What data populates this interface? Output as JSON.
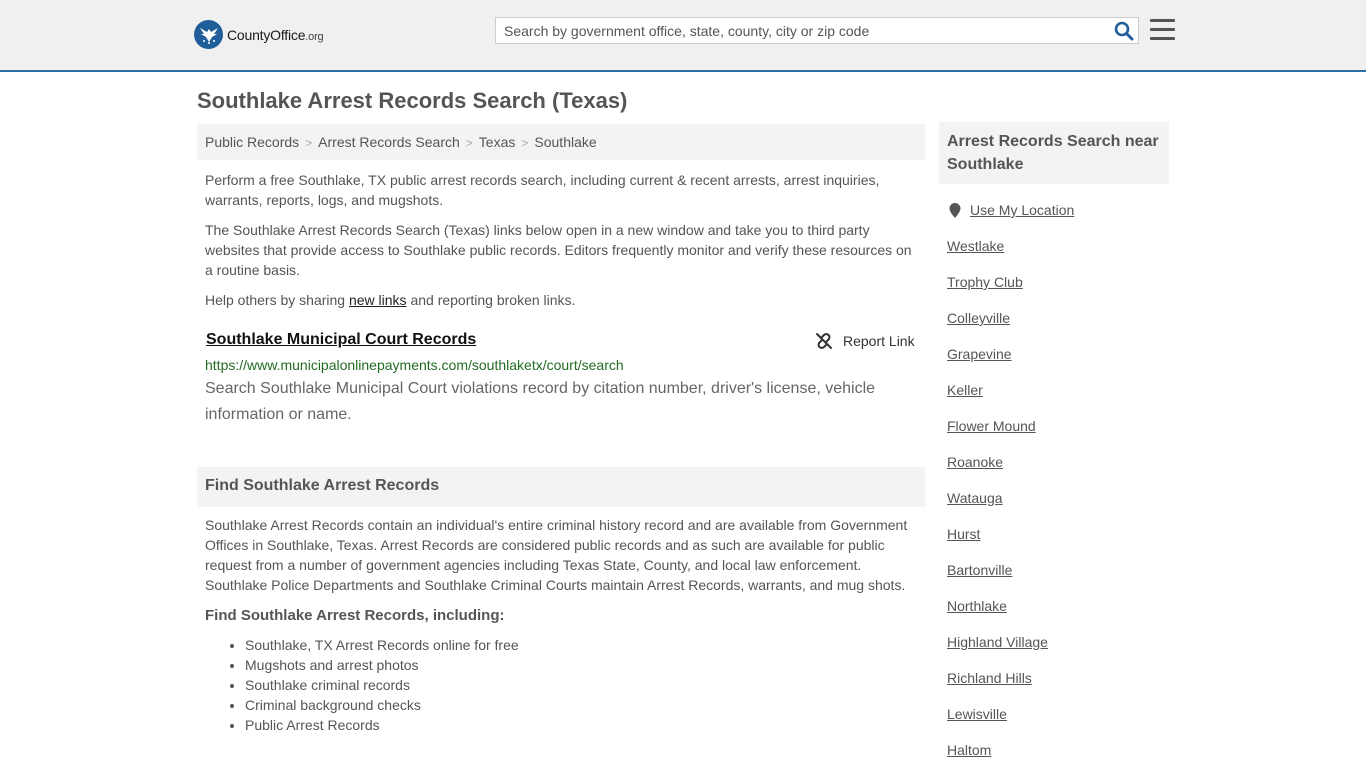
{
  "header": {
    "logo": {
      "name": "County",
      "accent": "Office",
      "tld": ".org"
    },
    "search": {
      "placeholder": "Search by government office, state, county, city or zip code"
    }
  },
  "page": {
    "title": "Southlake Arrest Records Search (Texas)"
  },
  "breadcrumb": [
    "Public Records",
    "Arrest Records Search",
    "Texas",
    "Southlake"
  ],
  "intro": {
    "p1": "Perform a free Southlake, TX public arrest records search, including current & recent arrests, arrest inquiries, warrants, reports, logs, and mugshots.",
    "p2": "The Southlake Arrest Records Search (Texas) links below open in a new window and take you to third party websites that provide access to Southlake public records. Editors frequently monitor and verify these resources on a routine basis.",
    "p3_before": "Help others by sharing ",
    "p3_link": "new links",
    "p3_after": " and reporting broken links."
  },
  "record": {
    "title": "Southlake Municipal Court Records",
    "report_label": "Report Link",
    "url": "https://www.municipalonlinepayments.com/southlaketx/court/search",
    "description": "Search Southlake Municipal Court violations record by citation number, driver's license, vehicle information or name."
  },
  "find_section": {
    "heading": "Find Southlake Arrest Records",
    "body": "Southlake Arrest Records contain an individual's entire criminal history record and are available from Government Offices in Southlake, Texas. Arrest Records are considered public records and as such are available for public request from a number of government agencies including Texas State, County, and local law enforcement. Southlake Police Departments and Southlake Criminal Courts maintain Arrest Records, warrants, and mug shots.",
    "subheading": "Find Southlake Arrest Records, including:",
    "bullets": [
      "Southlake, TX Arrest Records online for free",
      "Mugshots and arrest photos",
      "Southlake criminal records",
      "Criminal background checks",
      "Public Arrest Records"
    ]
  },
  "sidebar": {
    "heading": "Arrest Records Search near Southlake",
    "use_location": "Use My Location",
    "nearby": [
      "Westlake",
      "Trophy Club",
      "Colleyville",
      "Grapevine",
      "Keller",
      "Flower Mound",
      "Roanoke",
      "Watauga",
      "Hurst",
      "Bartonville",
      "Northlake",
      "Highland Village",
      "Richland Hills",
      "Lewisville",
      "Haltom"
    ]
  },
  "colors": {
    "brand_blue": "#1f5e99",
    "url_green": "#236b23",
    "header_border": "#2c6da3"
  }
}
